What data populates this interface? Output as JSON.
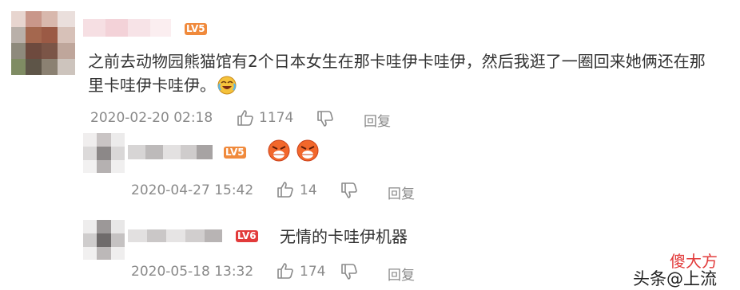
{
  "comments": [
    {
      "level": "LV5",
      "text_line1": "之前去动物园熊猫馆有2个日本女生在那卡哇伊卡哇伊，然后我逛了一圈回来她俩还在那",
      "text_line2": "里卡哇伊卡哇伊。",
      "emoji": "laughing-cry-emoji",
      "timestamp": "2020-02-20 02:18",
      "likes": "1174",
      "reply_label": "回复"
    },
    {
      "level": "LV5",
      "emoji": "angry-face-emoji",
      "timestamp": "2020-04-27 15:42",
      "likes": "14",
      "reply_label": "回复"
    },
    {
      "level": "LV6",
      "text": "无情的卡哇伊机器",
      "timestamp": "2020-05-18 13:32",
      "likes": "174",
      "reply_label": "回复"
    }
  ],
  "watermark": {
    "text1": "头条",
    "text2": "@上流",
    "logo": "傻大方"
  },
  "colors": {
    "lv5": "#f08a3c",
    "lv6": "#e23b3b",
    "meta": "#8a8a8a"
  }
}
